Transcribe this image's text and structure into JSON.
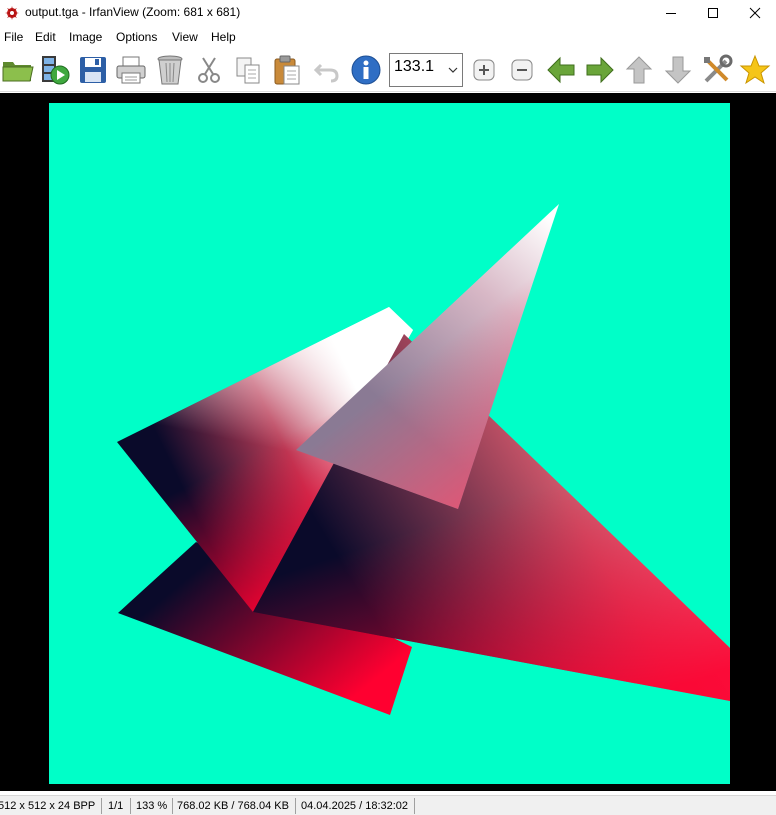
{
  "window": {
    "title": "output.tga - IrfanView (Zoom: 681 x 681)"
  },
  "menu": {
    "items": [
      "File",
      "Edit",
      "Image",
      "Options",
      "View",
      "Help"
    ]
  },
  "toolbar": {
    "zoom_value": "133.1",
    "icons": [
      "open-folder-icon",
      "slideshow-icon",
      "save-icon",
      "print-icon",
      "delete-icon",
      "cut-icon",
      "copy-icon",
      "paste-icon",
      "undo-icon",
      "info-icon",
      "zoom-in-icon",
      "zoom-out-icon",
      "previous-icon",
      "next-icon",
      "up-icon",
      "down-icon",
      "settings-icon",
      "favorite-icon"
    ]
  },
  "canvas": {
    "background_color": "#00FFC8",
    "viewer_background": "#000000"
  },
  "status": {
    "dimensions": "512 x 512 x 24 BPP",
    "page": "1/1",
    "zoom": "133 %",
    "size": "768.02 KB / 768.04 KB",
    "datetime": "04.04.2025 / 18:32:02"
  },
  "colors": {
    "triangle_dark": "#0A0A2A",
    "triangle_red": "#FF0030",
    "triangle_white": "#FFFFFF",
    "triangle_pink": "#F06478"
  }
}
